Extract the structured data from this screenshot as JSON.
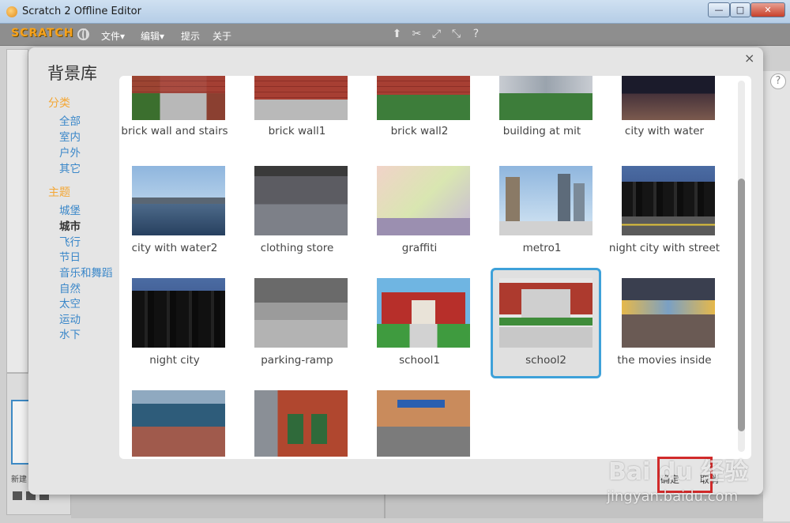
{
  "window": {
    "title": "Scratch 2 Offline Editor",
    "min_glyph": "—",
    "max_glyph": "□",
    "close_glyph": "✕"
  },
  "menubar": {
    "logo": "SCRATCH",
    "items": [
      "文件▾",
      "编辑▾",
      "提示",
      "关于"
    ]
  },
  "sidebar_bg": {
    "new_label": "新建"
  },
  "dialog": {
    "title": "背景库",
    "close_glyph": "×",
    "filters": {
      "category_heading": "分类",
      "categories": [
        "全部",
        "室内",
        "户外",
        "其它"
      ],
      "theme_heading": "主题",
      "themes": [
        "城堡",
        "城市",
        "飞行",
        "节日",
        "音乐和舞蹈",
        "自然",
        "太空",
        "运动",
        "水下"
      ],
      "active_theme": "城市"
    },
    "items": [
      {
        "label": "brick wall and stairs"
      },
      {
        "label": "brick wall1"
      },
      {
        "label": "brick wall2"
      },
      {
        "label": "building at mit"
      },
      {
        "label": "city with water"
      },
      {
        "label": "city with water2"
      },
      {
        "label": "clothing store"
      },
      {
        "label": "graffiti"
      },
      {
        "label": "metro1"
      },
      {
        "label": "night city with street"
      },
      {
        "label": "night city"
      },
      {
        "label": "parking-ramp"
      },
      {
        "label": "school1"
      },
      {
        "label": "school2"
      },
      {
        "label": "the movies inside"
      },
      {
        "label": ""
      },
      {
        "label": ""
      },
      {
        "label": ""
      }
    ],
    "selected_label": "school2",
    "buttons": {
      "ok": "确定",
      "cancel": "取消"
    }
  },
  "watermark": {
    "brand": "Bai du 经验",
    "url": "jingyan.baidu.com"
  }
}
